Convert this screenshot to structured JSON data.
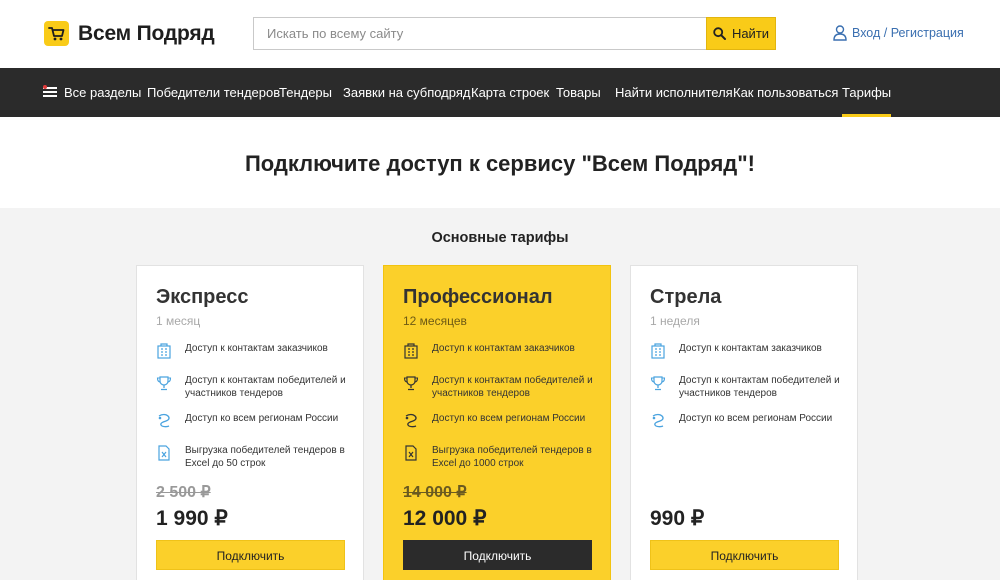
{
  "header": {
    "logo_text": "Всем Подряд",
    "search_placeholder": "Искать по всему сайту",
    "search_button": "Найти",
    "login_link": "Вход / Регистрация"
  },
  "nav": {
    "items": [
      "Все разделы",
      "Победители тендеров",
      "Тендеры",
      "Заявки на субподряд",
      "Карта строек",
      "Товары",
      "Найти исполнителя",
      "Как пользоваться",
      "Тарифы"
    ],
    "active": "Тарифы"
  },
  "page_title": "Подключите доступ к сервису \"Всем Подряд\"!",
  "section_title": "Основные тарифы",
  "plans": [
    {
      "name": "Экспресс",
      "period": "1 месяц",
      "features": [
        "Доступ к контактам заказчиков",
        "Доступ к контактам победителей и участников тендеров",
        "Доступ ко всем регионам России",
        "Выгрузка победителей тендеров в Excel до 50 строк"
      ],
      "old_price": "2 500 ₽",
      "price": "1 990 ₽",
      "button": "Подключить"
    },
    {
      "name": "Профессионал",
      "period": "12 месяцев",
      "features": [
        "Доступ к контактам заказчиков",
        "Доступ к контактам победителей и участников тендеров",
        "Доступ ко всем регионам России",
        "Выгрузка победителей тендеров в Excel до 1000 строк"
      ],
      "old_price": "14 000 ₽",
      "price": "12 000 ₽",
      "button": "Подключить"
    },
    {
      "name": "Стрела",
      "period": "1 неделя",
      "features": [
        "Доступ к контактам заказчиков",
        "Доступ к контактам победителей и участников тендеров",
        "Доступ ко всем регионам России"
      ],
      "old_price": "",
      "price": "990 ₽",
      "button": "Подключить"
    }
  ],
  "colors": {
    "accent": "#f9cb18",
    "dark": "#2b2b2b",
    "icon_blue": "#4aa3df",
    "link": "#3a6fb0"
  }
}
